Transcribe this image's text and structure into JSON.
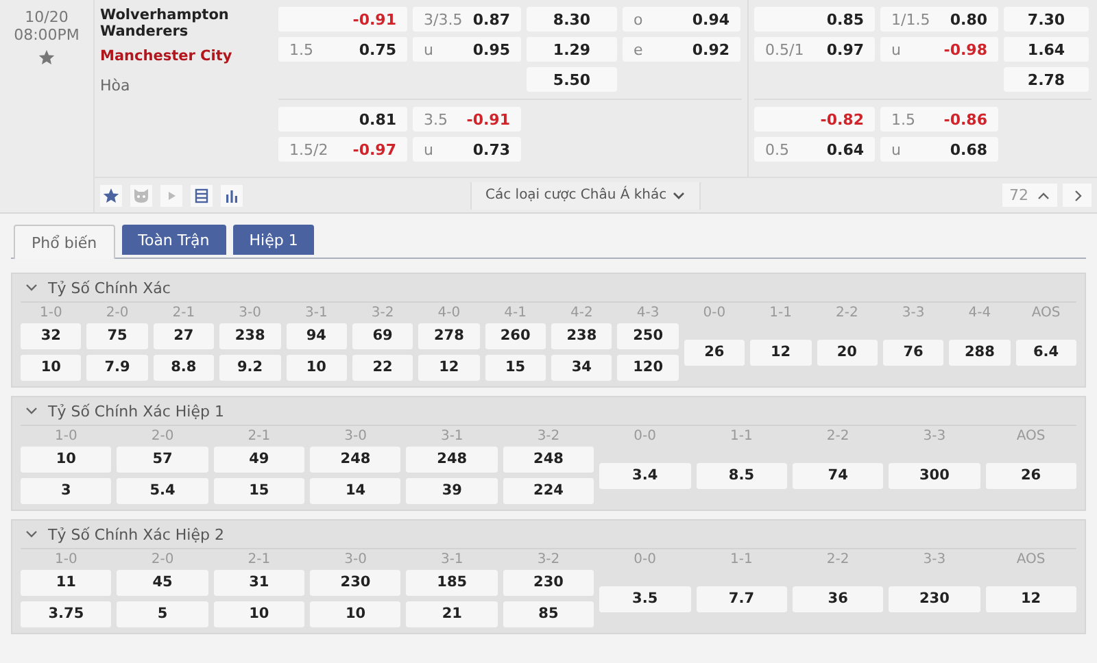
{
  "match": {
    "date": "10/20",
    "time": "08:00PM",
    "home": "Wolverhampton Wanderers",
    "away": "Manchester City",
    "draw": "Hòa"
  },
  "markets": [
    {
      "kind": "full_time",
      "blocks": [
        {
          "columns": [
            {
              "kind": "handicap",
              "cells": [
                {
                  "odds": "-0.91",
                  "negative": true
                },
                {
                  "line": "1.5",
                  "odds": "0.75",
                  "negative": false
                }
              ]
            },
            {
              "kind": "overunder",
              "cells": [
                {
                  "line": "3/3.5",
                  "odds": "0.87",
                  "negative": false
                },
                {
                  "line": "u",
                  "odds": "0.95",
                  "negative": false
                }
              ]
            },
            {
              "kind": "x12",
              "cells": [
                {
                  "odds": "8.30",
                  "negative": false
                },
                {
                  "odds": "1.29",
                  "negative": false
                },
                {
                  "odds": "5.50",
                  "negative": false
                }
              ]
            },
            {
              "kind": "oddeven",
              "cells": [
                {
                  "line": "o",
                  "odds": "0.94",
                  "negative": false
                },
                {
                  "line": "e",
                  "odds": "0.92",
                  "negative": false
                }
              ]
            }
          ]
        },
        {
          "columns": [
            {
              "kind": "handicap",
              "cells": [
                {
                  "odds": "0.81",
                  "negative": false
                },
                {
                  "line": "1.5/2",
                  "odds": "-0.97",
                  "negative": true
                }
              ]
            },
            {
              "kind": "overunder",
              "cells": [
                {
                  "line": "3.5",
                  "odds": "-0.91",
                  "negative": true
                },
                {
                  "line": "u",
                  "odds": "0.73",
                  "negative": false
                }
              ]
            }
          ]
        }
      ]
    },
    {
      "kind": "first_half",
      "blocks": [
        {
          "columns": [
            {
              "kind": "handicap",
              "cells": [
                {
                  "odds": "0.85",
                  "negative": false
                },
                {
                  "line": "0.5/1",
                  "odds": "0.97",
                  "negative": false
                }
              ]
            },
            {
              "kind": "overunder",
              "cells": [
                {
                  "line": "1/1.5",
                  "odds": "0.80",
                  "negative": false
                },
                {
                  "line": "u",
                  "odds": "-0.98",
                  "negative": true
                }
              ]
            },
            {
              "kind": "x12",
              "cells": [
                {
                  "odds": "7.30",
                  "negative": false
                },
                {
                  "odds": "1.64",
                  "negative": false
                },
                {
                  "odds": "2.78",
                  "negative": false
                }
              ]
            }
          ]
        },
        {
          "columns": [
            {
              "kind": "handicap",
              "cells": [
                {
                  "odds": "-0.82",
                  "negative": true
                },
                {
                  "line": "0.5",
                  "odds": "0.64",
                  "negative": false
                }
              ]
            },
            {
              "kind": "overunder",
              "cells": [
                {
                  "line": "1.5",
                  "odds": "-0.86",
                  "negative": true
                },
                {
                  "line": "u",
                  "odds": "0.68",
                  "negative": false
                }
              ]
            }
          ]
        }
      ]
    }
  ],
  "more_bets": "Các loại cược Châu Á khác",
  "market_count": "72",
  "tabs": [
    {
      "label": "Phổ biến",
      "selected": true
    },
    {
      "label": "Toàn Trận",
      "selected": false
    },
    {
      "label": "Hiệp 1",
      "selected": false
    }
  ],
  "sections": [
    {
      "title": "Tỷ Số Chính Xác",
      "expanded": true,
      "columns": [
        {
          "score": "1-0",
          "odds": [
            "32",
            "10"
          ]
        },
        {
          "score": "2-0",
          "odds": [
            "75",
            "7.9"
          ]
        },
        {
          "score": "2-1",
          "odds": [
            "27",
            "8.8"
          ]
        },
        {
          "score": "3-0",
          "odds": [
            "238",
            "9.2"
          ]
        },
        {
          "score": "3-1",
          "odds": [
            "94",
            "10"
          ]
        },
        {
          "score": "3-2",
          "odds": [
            "69",
            "22"
          ]
        },
        {
          "score": "4-0",
          "odds": [
            "278",
            "12"
          ]
        },
        {
          "score": "4-1",
          "odds": [
            "260",
            "15"
          ]
        },
        {
          "score": "4-2",
          "odds": [
            "238",
            "34"
          ]
        },
        {
          "score": "4-3",
          "odds": [
            "250",
            "120"
          ]
        },
        {
          "score": "0-0",
          "odds": [
            "26"
          ]
        },
        {
          "score": "1-1",
          "odds": [
            "12"
          ]
        },
        {
          "score": "2-2",
          "odds": [
            "20"
          ]
        },
        {
          "score": "3-3",
          "odds": [
            "76"
          ]
        },
        {
          "score": "4-4",
          "odds": [
            "288"
          ]
        },
        {
          "score": "AOS",
          "odds": [
            "6.4"
          ]
        }
      ]
    },
    {
      "title": "Tỷ Số Chính Xác Hiệp 1",
      "expanded": true,
      "columns": [
        {
          "score": "1-0",
          "odds": [
            "10",
            "3"
          ]
        },
        {
          "score": "2-0",
          "odds": [
            "57",
            "5.4"
          ]
        },
        {
          "score": "2-1",
          "odds": [
            "49",
            "15"
          ]
        },
        {
          "score": "3-0",
          "odds": [
            "248",
            "14"
          ]
        },
        {
          "score": "3-1",
          "odds": [
            "248",
            "39"
          ]
        },
        {
          "score": "3-2",
          "odds": [
            "248",
            "224"
          ]
        },
        {
          "score": "0-0",
          "odds": [
            "3.4"
          ]
        },
        {
          "score": "1-1",
          "odds": [
            "8.5"
          ]
        },
        {
          "score": "2-2",
          "odds": [
            "74"
          ]
        },
        {
          "score": "3-3",
          "odds": [
            "300"
          ]
        },
        {
          "score": "AOS",
          "odds": [
            "26"
          ]
        }
      ]
    },
    {
      "title": "Tỷ Số Chính Xác Hiệp 2",
      "expanded": true,
      "columns": [
        {
          "score": "1-0",
          "odds": [
            "11",
            "3.75"
          ]
        },
        {
          "score": "2-0",
          "odds": [
            "45",
            "5"
          ]
        },
        {
          "score": "2-1",
          "odds": [
            "31",
            "10"
          ]
        },
        {
          "score": "3-0",
          "odds": [
            "230",
            "10"
          ]
        },
        {
          "score": "3-1",
          "odds": [
            "185",
            "21"
          ]
        },
        {
          "score": "3-2",
          "odds": [
            "230",
            "85"
          ]
        },
        {
          "score": "0-0",
          "odds": [
            "3.5"
          ]
        },
        {
          "score": "1-1",
          "odds": [
            "7.7"
          ]
        },
        {
          "score": "2-2",
          "odds": [
            "36"
          ]
        },
        {
          "score": "3-3",
          "odds": [
            "230"
          ]
        },
        {
          "score": "AOS",
          "odds": [
            "12"
          ]
        }
      ]
    }
  ]
}
